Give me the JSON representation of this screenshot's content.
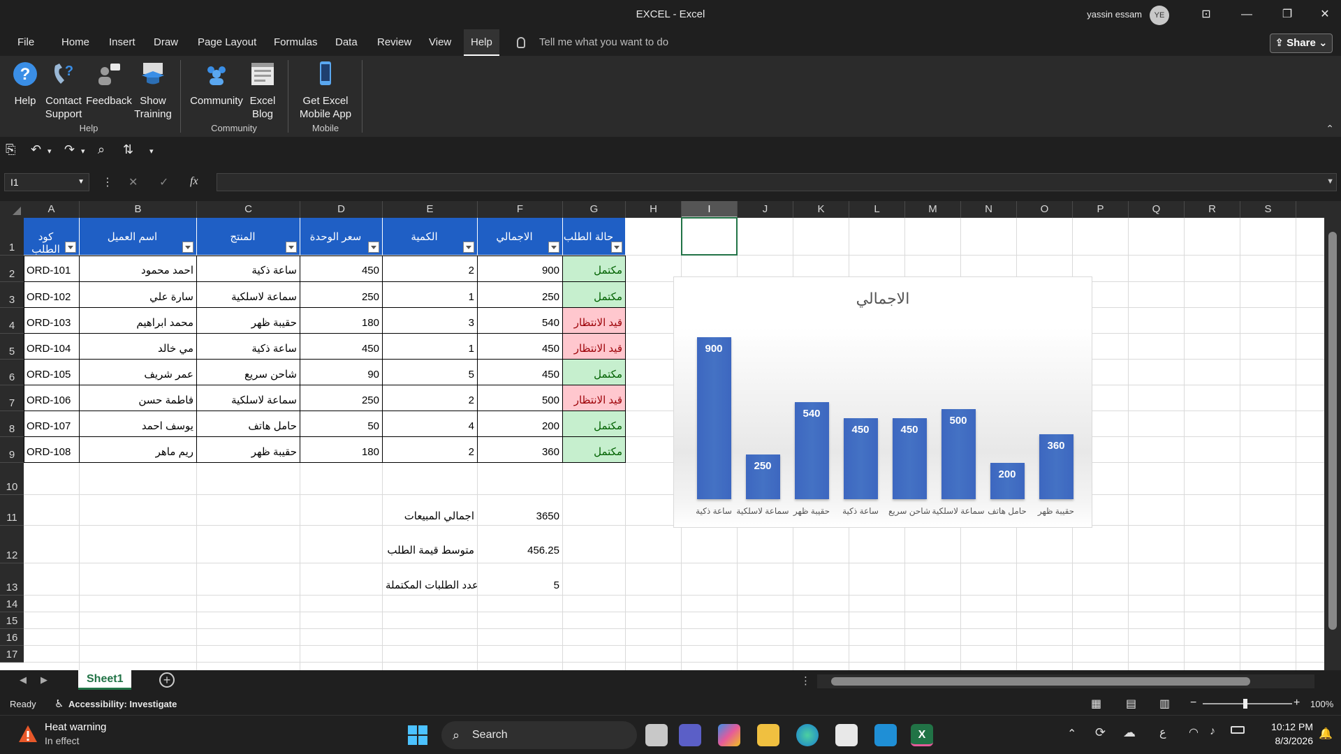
{
  "window": {
    "title": "EXCEL  -  Excel",
    "user_name": "yassin essam",
    "avatar_initials": "YE"
  },
  "menu": {
    "tabs": [
      "File",
      "Home",
      "Insert",
      "Draw",
      "Page Layout",
      "Formulas",
      "Data",
      "Review",
      "View",
      "Help"
    ],
    "active_tab": "Help",
    "tell_me": "Tell me what you want to do",
    "share": "Share"
  },
  "ribbon": {
    "buttons": [
      {
        "line1": "Help",
        "line2": ""
      },
      {
        "line1": "Contact",
        "line2": "Support"
      },
      {
        "line1": "Feedback",
        "line2": ""
      },
      {
        "line1": "Show",
        "line2": "Training"
      },
      {
        "line1": "Community",
        "line2": ""
      },
      {
        "line1": "Excel",
        "line2": "Blog"
      },
      {
        "line1": "Get Excel",
        "line2": "Mobile App"
      }
    ],
    "groups": [
      "Help",
      "Community",
      "Mobile"
    ]
  },
  "formula_bar": {
    "name_box": "I1",
    "fx": "fx",
    "value": ""
  },
  "columns": [
    "A",
    "B",
    "C",
    "D",
    "E",
    "F",
    "G",
    "H",
    "I",
    "J",
    "K",
    "L",
    "M",
    "N",
    "O",
    "P",
    "Q",
    "R",
    "S"
  ],
  "rows": [
    "1",
    "2",
    "3",
    "4",
    "5",
    "6",
    "7",
    "8",
    "9",
    "10",
    "11",
    "12",
    "13",
    "14",
    "15",
    "16",
    "17"
  ],
  "table": {
    "headers": [
      "كود الطلب",
      "اسم العميل",
      "المنتج",
      "سعر الوحدة",
      "الكمية",
      "الاجمالي",
      "حالة الطلب"
    ],
    "rows": [
      [
        "ORD-101",
        "احمد محمود",
        "ساعة ذكية",
        "450",
        "2",
        "900",
        "مكتمل"
      ],
      [
        "ORD-102",
        "سارة علي",
        "سماعة لاسلكية",
        "250",
        "1",
        "250",
        "مكتمل"
      ],
      [
        "ORD-103",
        "محمد ابراهيم",
        "حقيبة ظهر",
        "180",
        "3",
        "540",
        "قيد الانتظار"
      ],
      [
        "ORD-104",
        "مي خالد",
        "ساعة ذكية",
        "450",
        "1",
        "450",
        "قيد الانتظار"
      ],
      [
        "ORD-105",
        "عمر شريف",
        "شاحن سريع",
        "90",
        "5",
        "450",
        "مكتمل"
      ],
      [
        "ORD-106",
        "فاطمة حسن",
        "سماعة لاسلكية",
        "250",
        "2",
        "500",
        "قيد الانتظار"
      ],
      [
        "ORD-107",
        "يوسف احمد",
        "حامل هاتف",
        "50",
        "4",
        "200",
        "مكتمل"
      ],
      [
        "ORD-108",
        "ريم ماهر",
        "حقيبة ظهر",
        "180",
        "2",
        "360",
        "مكتمل"
      ]
    ],
    "status_complete": "مكتمل"
  },
  "summary": [
    {
      "label": "اجمالي المبيعات",
      "value": "3650"
    },
    {
      "label": "متوسط قيمة الطلب",
      "value": "456.25"
    },
    {
      "label": "عدد الطلبات المكتملة",
      "value": "5"
    }
  ],
  "chart_data": {
    "type": "bar",
    "title": "الاجمالي",
    "categories": [
      "ساعة ذكية",
      "سماعة لاسلكية",
      "حقيبة ظهر",
      "ساعة ذكية",
      "شاحن سريع",
      "سماعة لاسلكية",
      "حامل هاتف",
      "حقيبة ظهر"
    ],
    "values": [
      900,
      250,
      540,
      450,
      450,
      500,
      200,
      360
    ],
    "ylim": [
      0,
      1000
    ],
    "grid": false,
    "legend": "none",
    "bar_color": "#4472c4"
  },
  "sheets": {
    "active": "Sheet1"
  },
  "status": {
    "ready": "Ready",
    "accessibility": "Accessibility: Investigate",
    "zoom": "100%"
  },
  "taskbar": {
    "weather_title": "Heat warning",
    "weather_sub": "In effect",
    "search": "Search",
    "lang": "ع",
    "time": "10:12 PM",
    "date": "8/3/2026"
  },
  "colors": {
    "header_blue": "#1f5fc5",
    "complete_bg": "#c6efce",
    "complete_fg": "#006100",
    "pending_bg": "#ffc7ce",
    "pending_fg": "#9c0006",
    "excel_green": "#217346"
  }
}
